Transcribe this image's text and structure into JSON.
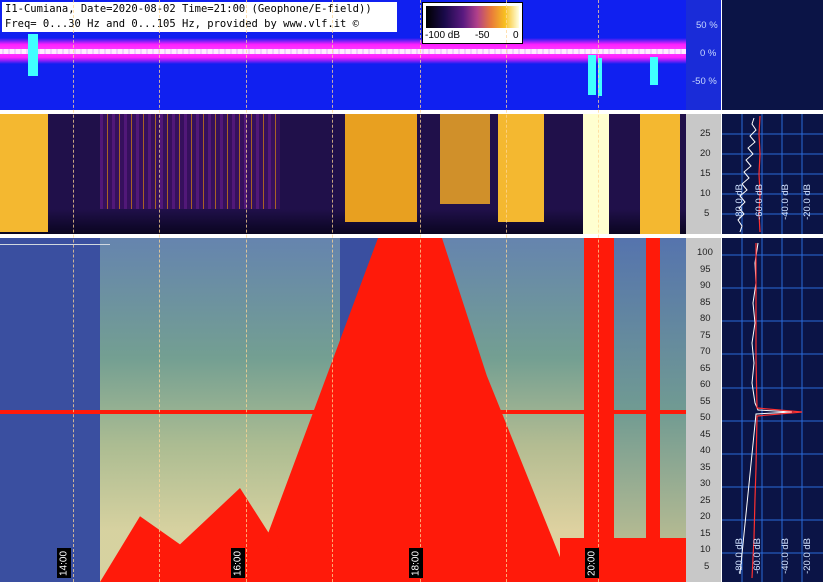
{
  "header": {
    "title_line1": "I1-Cumiana, Date=2020-08-02 Time=21:00 (Geophone/E-field))",
    "title_line2": "Freq= 0...30 Hz and 0...105 Hz, provided by www.vlf.it ©"
  },
  "colorbar": {
    "min_label": "-100 dB",
    "mid_label": "-50",
    "max_label": "0"
  },
  "amplitude_panel": {
    "ticks": [
      "50 %",
      "0 %",
      "-50 %"
    ]
  },
  "panel_30hz": {
    "ticks": [
      "25",
      "20",
      "15",
      "10",
      "5"
    ]
  },
  "panel_105hz": {
    "ticks": [
      "100",
      "95",
      "90",
      "85",
      "80",
      "75",
      "70",
      "65",
      "60",
      "55",
      "50",
      "45",
      "40",
      "35",
      "30",
      "25",
      "20",
      "15",
      "10",
      "5"
    ]
  },
  "profile_30hz": {
    "labels": [
      "-80.0 dB",
      "-60.0 dB",
      "-40.0 dB",
      "-20.0 dB"
    ]
  },
  "profile_105hz": {
    "labels": [
      "-80.0 dB",
      "-60.0 dB",
      "-40.0 dB",
      "-20.0 dB"
    ]
  },
  "time_axis": {
    "labels": [
      "14:00",
      "16:00",
      "18:00",
      "20:00"
    ]
  },
  "colors": {
    "amp_background": "#1020f0",
    "amp_magenta": "#ff20ff",
    "panel_dark": "#20104a",
    "panel_gold": "#f4b830",
    "spec_blue": "#3a4fa0",
    "spec_green": "#7aa890",
    "spec_red": "#ff1a0a",
    "profile_bg": "#0b1446"
  }
}
